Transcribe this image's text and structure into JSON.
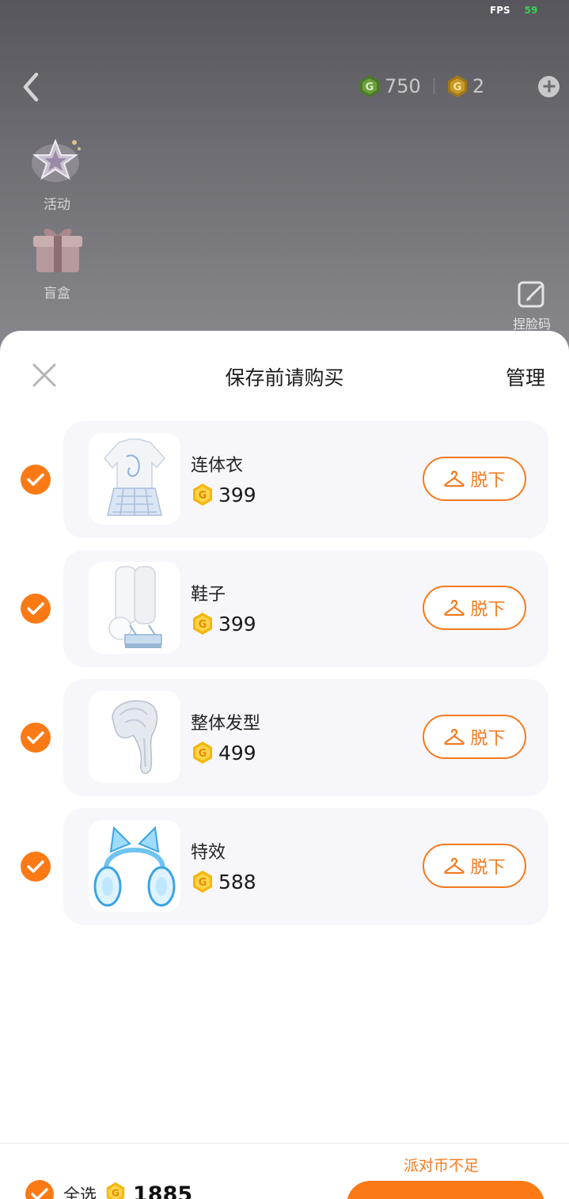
{
  "hud": {
    "fps_label": "FPS",
    "fps_value": "59",
    "green_currency": "750",
    "gold_currency": "2"
  },
  "side_menu": {
    "items": [
      {
        "label": "活动",
        "icon": "star-event-icon"
      },
      {
        "label": "盲盒",
        "icon": "gift-box-icon"
      }
    ],
    "face_code_label": "捏脸码"
  },
  "sheet": {
    "title": "保存前请购买",
    "manage_label": "管理",
    "takeoff_label": "脱下",
    "items": [
      {
        "name": "连体衣",
        "price": "399",
        "checked": true,
        "thumb": "dress-thumbnail"
      },
      {
        "name": "鞋子",
        "price": "399",
        "checked": true,
        "thumb": "boots-thumbnail"
      },
      {
        "name": "整体发型",
        "price": "499",
        "checked": true,
        "thumb": "hair-thumbnail"
      },
      {
        "name": "特效",
        "price": "588",
        "checked": true,
        "thumb": "cat-ear-headphones-thumbnail"
      }
    ]
  },
  "footer": {
    "select_all_label": "全选",
    "total": "1885",
    "insufficient_label": "派对币不足"
  },
  "colors": {
    "accent": "#fb7a16",
    "accent_text": "#f47a20",
    "card_bg": "#f7f6fa",
    "coin_gold": "#f5b70c",
    "coin_green": "#4caf2a"
  }
}
